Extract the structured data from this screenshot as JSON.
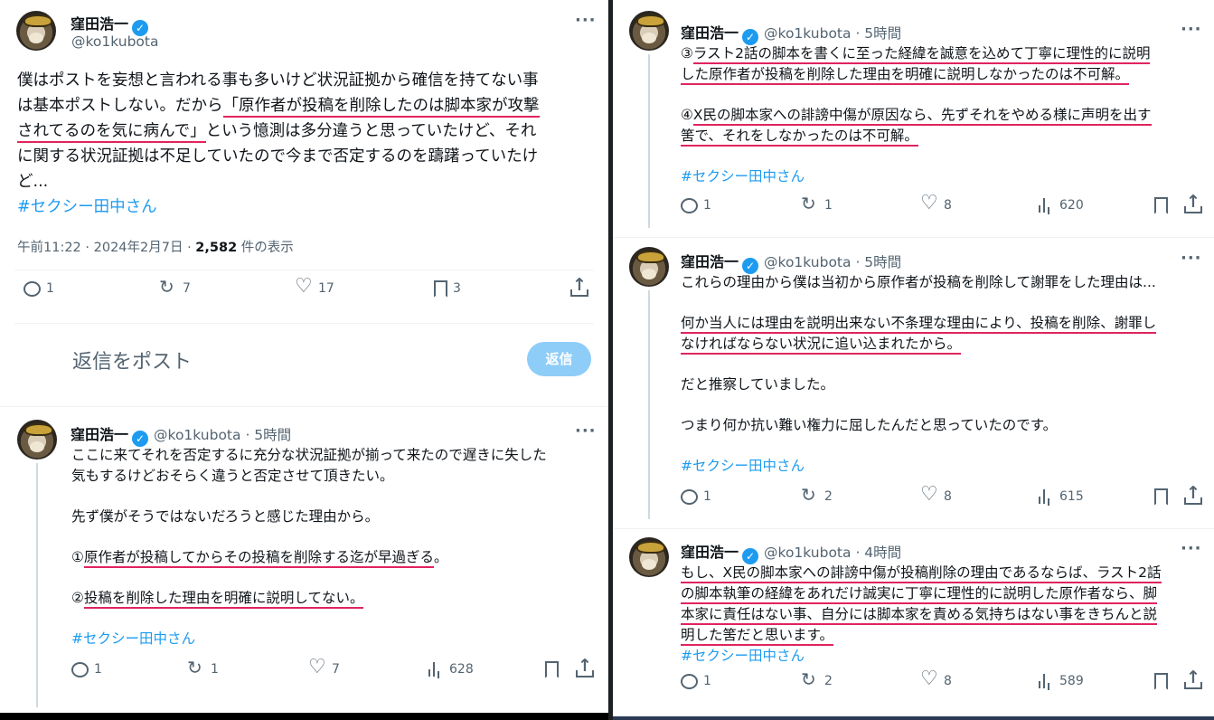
{
  "main_tweet": {
    "display_name": "窪田浩一",
    "handle": "@ko1kubota",
    "lines": [
      {
        "pre": "僕はポストを妄想と言われる事も多いけど状況証拠から確信を持てない事",
        "hl": "",
        "post": ""
      },
      {
        "pre": "は基本ポストしない。だから",
        "hl": "「原作者が投稿を削除したのは脚本家が攻撃",
        "post": ""
      },
      {
        "pre": "",
        "hl": "されてるのを気に病んで」",
        "post": "という憶測は多分違うと思っていたけど、それ"
      },
      {
        "pre": "に関する状況証拠は不足していたので今まで否定するのを躊躇っていたけ",
        "hl": "",
        "post": ""
      },
      {
        "pre": "ど...",
        "hl": "",
        "post": ""
      }
    ],
    "hashtag": "#セクシー田中さん",
    "time_prefix": "午前11:22 · 2024年2月7日 · ",
    "views": "2,582",
    "views_suffix": " 件の表示",
    "stats": {
      "reply": "1",
      "retweet": "7",
      "like": "17",
      "bookmark": "3"
    }
  },
  "reply_box": {
    "placeholder": "返信をポスト",
    "button": "返信"
  },
  "left_reply": {
    "display_name": "窪田浩一",
    "handle": "@ko1kubota",
    "time": "5時間",
    "l1": "ここに来てそれを否定するに充分な状況証拠が揃って来たので遅きに失した",
    "l2": "気もするけどおそらく違うと否定させて頂きたい。",
    "l3": "先ず僕がそうではないだろうと感じた理由から。",
    "l4_pre": "①",
    "l4_hl": "原作者が投稿してからその投稿を削除する迄が早過ぎる",
    "l4_post": "。",
    "l5_pre": "②",
    "l5_hl": "投稿を削除した理由を明確に説明してない。",
    "hashtag": "#セクシー田中さん",
    "stats": {
      "reply": "1",
      "retweet": "1",
      "like": "7",
      "views": "628"
    }
  },
  "r1": {
    "display_name": "窪田浩一",
    "handle": "@ko1kubota",
    "time": "5時間",
    "l1_pre": "③",
    "l1_hl": "ラスト2話の脚本を書くに至った経緯を誠意を込めて丁寧に理性的に説明",
    "l2_hl": "した原作者が投稿を削除した理由を明確に説明しなかったのは不可解。",
    "l3_pre": "④",
    "l3_hl": "X民の脚本家への誹謗中傷が原因なら、先ずそれをやめる様に声明を出す",
    "l4_hl": "筈で、それをしなかったのは不可解。",
    "hashtag": "#セクシー田中さん",
    "stats": {
      "reply": "1",
      "retweet": "1",
      "like": "8",
      "views": "620"
    }
  },
  "r2": {
    "display_name": "窪田浩一",
    "handle": "@ko1kubota",
    "time": "5時間",
    "l1": "これらの理由から僕は当初から原作者が投稿を削除して謝罪をした理由は...",
    "l2_hl": "何か当人には理由を説明出来ない不条理な理由により、投稿を削除、謝罪し",
    "l3_hl": "なければならない状況に追い込まれたから。",
    "l4": "だと推察していました。",
    "l5": "つまり何か抗い難い権力に屈したんだと思っていたのです。",
    "hashtag": "#セクシー田中さん",
    "stats": {
      "reply": "1",
      "retweet": "2",
      "like": "8",
      "views": "615"
    }
  },
  "r3": {
    "display_name": "窪田浩一",
    "handle": "@ko1kubota",
    "time": "4時間",
    "l1_hl": "もし、X民の脚本家への誹謗中傷が投稿削除の理由であるならば、ラスト2話",
    "l2_hl": "の脚本執筆の経緯をあれだけ誠実に丁寧に理性的に説明した原作者なら、脚",
    "l3_hl": "本家に責任はない事、自分には脚本家を責める気持ちはない事をきちんと説",
    "l4_hl": "明した筈だと思います。",
    "hashtag": "#セクシー田中さん",
    "stats": {
      "reply": "1",
      "retweet": "2",
      "like": "8",
      "views": "589"
    }
  }
}
